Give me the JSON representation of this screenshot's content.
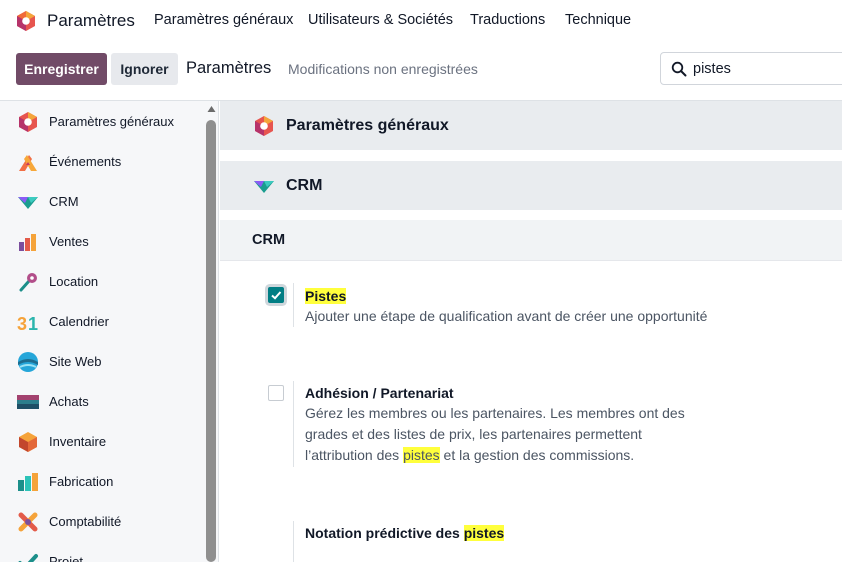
{
  "navbar": {
    "app_name": "Paramètres",
    "menus": [
      "Paramètres généraux",
      "Utilisateurs & Sociétés",
      "Traductions",
      "Technique"
    ]
  },
  "control_panel": {
    "save_label": "Enregistrer",
    "discard_label": "Ignorer",
    "title": "Paramètres",
    "status": "Modifications non enregistrées",
    "search_value": "pistes"
  },
  "sidebar": {
    "items": [
      {
        "label": "Paramètres généraux",
        "icon": "settings-app-icon"
      },
      {
        "label": "Événements",
        "icon": "events-app-icon"
      },
      {
        "label": "CRM",
        "icon": "crm-app-icon"
      },
      {
        "label": "Ventes",
        "icon": "sales-app-icon"
      },
      {
        "label": "Location",
        "icon": "rental-app-icon"
      },
      {
        "label": "Calendrier",
        "icon": "calendar-app-icon"
      },
      {
        "label": "Site Web",
        "icon": "website-app-icon"
      },
      {
        "label": "Achats",
        "icon": "purchase-app-icon"
      },
      {
        "label": "Inventaire",
        "icon": "inventory-app-icon"
      },
      {
        "label": "Fabrication",
        "icon": "manufacturing-app-icon"
      },
      {
        "label": "Comptabilité",
        "icon": "accounting-app-icon"
      },
      {
        "label": "Projet",
        "icon": "project-app-icon"
      }
    ]
  },
  "main": {
    "general_title": "Paramètres généraux",
    "crm_title": "CRM",
    "crm_section": "CRM",
    "settings": [
      {
        "title_hl": "Pistes",
        "title_rest": "",
        "checked": true,
        "desc_lines": [
          {
            "before": "Ajouter une étape de qualification avant de créer une opportunité",
            "hl": "",
            "after": ""
          }
        ]
      },
      {
        "title_hl": "",
        "title_rest": "Adhésion / Partenariat",
        "checked": false,
        "desc_lines": [
          {
            "before": "Gérez les membres ou les partenaires. Les membres ont des",
            "hl": "",
            "after": ""
          },
          {
            "before": "grades et des listes de prix, les partenaires permettent",
            "hl": "",
            "after": ""
          },
          {
            "before": "l’attribution des ",
            "hl": "pistes",
            "after": " et la gestion des commissions."
          }
        ]
      },
      {
        "title_pre": "Notation prédictive des ",
        "title_hl": "pistes",
        "checked": false
      }
    ]
  },
  "colors": {
    "brand": "#714b67",
    "checkbox_checked": "#017e84",
    "highlight": "#ffff3c",
    "band": "#e9ecef"
  }
}
